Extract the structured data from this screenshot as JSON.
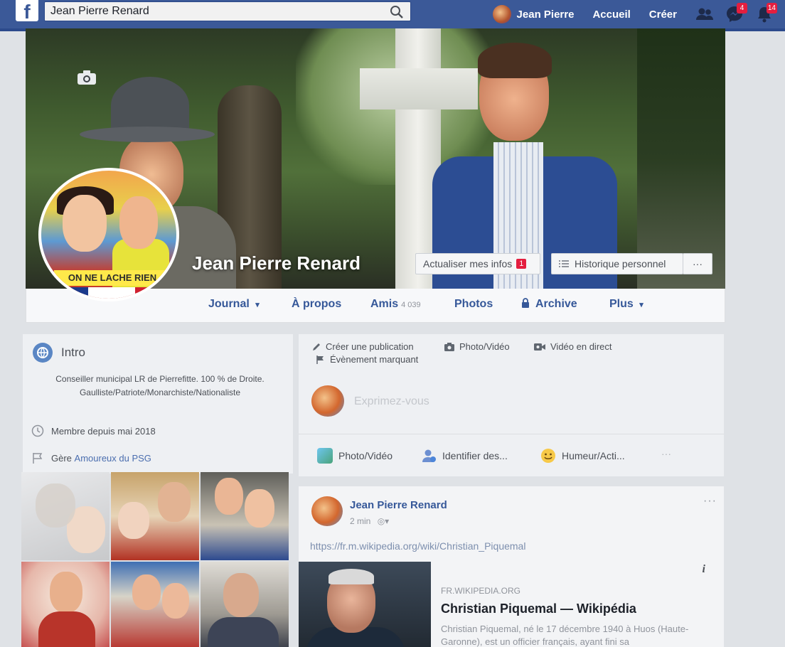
{
  "header": {
    "search_value": "Jean Pierre Renard",
    "user_name": "Jean Pierre",
    "home_label": "Accueil",
    "create_label": "Créer",
    "messages_count": "4",
    "notifications_count": "14"
  },
  "cover": {
    "profile_name": "Jean Pierre Renard",
    "profile_banner_text": "ON NE LACHE RIEN",
    "update_info_label": "Actualiser mes infos",
    "update_info_badge": "1",
    "activity_log_label": "Historique personnel",
    "more_label": "···"
  },
  "tabs": {
    "journal": "Journal",
    "about": "À propos",
    "friends": "Amis",
    "friends_count": "4 039",
    "photos": "Photos",
    "archive": "Archive",
    "more": "Plus"
  },
  "intro": {
    "title": "Intro",
    "bio": "Conseiller municipal LR de Pierrefitte. 100 % de Droite. Gaulliste/Patriote/Monarchiste/Nationaliste",
    "member_since": "Membre depuis mai 2018",
    "manages_prefix": "Gère",
    "manages_page": "Amoureux du PSG"
  },
  "composer": {
    "create_post": "Créer une publication",
    "photo_video": "Photo/Vidéo",
    "live_video": "Vidéo en direct",
    "life_event": "Évènement marquant",
    "placeholder": "Exprimez-vous",
    "btn_photo": "Photo/Vidéo",
    "btn_tag": "Identifier des...",
    "btn_feeling": "Humeur/Acti...",
    "btn_more": "···"
  },
  "post": {
    "author": "Jean Pierre Renard",
    "time": "2 min",
    "more": "···",
    "url": "https://fr.m.wikipedia.org/wiki/Christian_Piquemal",
    "link_domain": "FR.WIKIPEDIA.ORG",
    "link_title": "Christian Piquemal — Wikipédia",
    "link_desc": "Christian Piquemal, né le 17 décembre 1940 à Huos (Haute-Garonne), est un officier français, ayant fini sa",
    "info_glyph": "i"
  },
  "colors": {
    "brand": "#3b5998",
    "link": "#365899",
    "badge": "#e41e3f"
  }
}
